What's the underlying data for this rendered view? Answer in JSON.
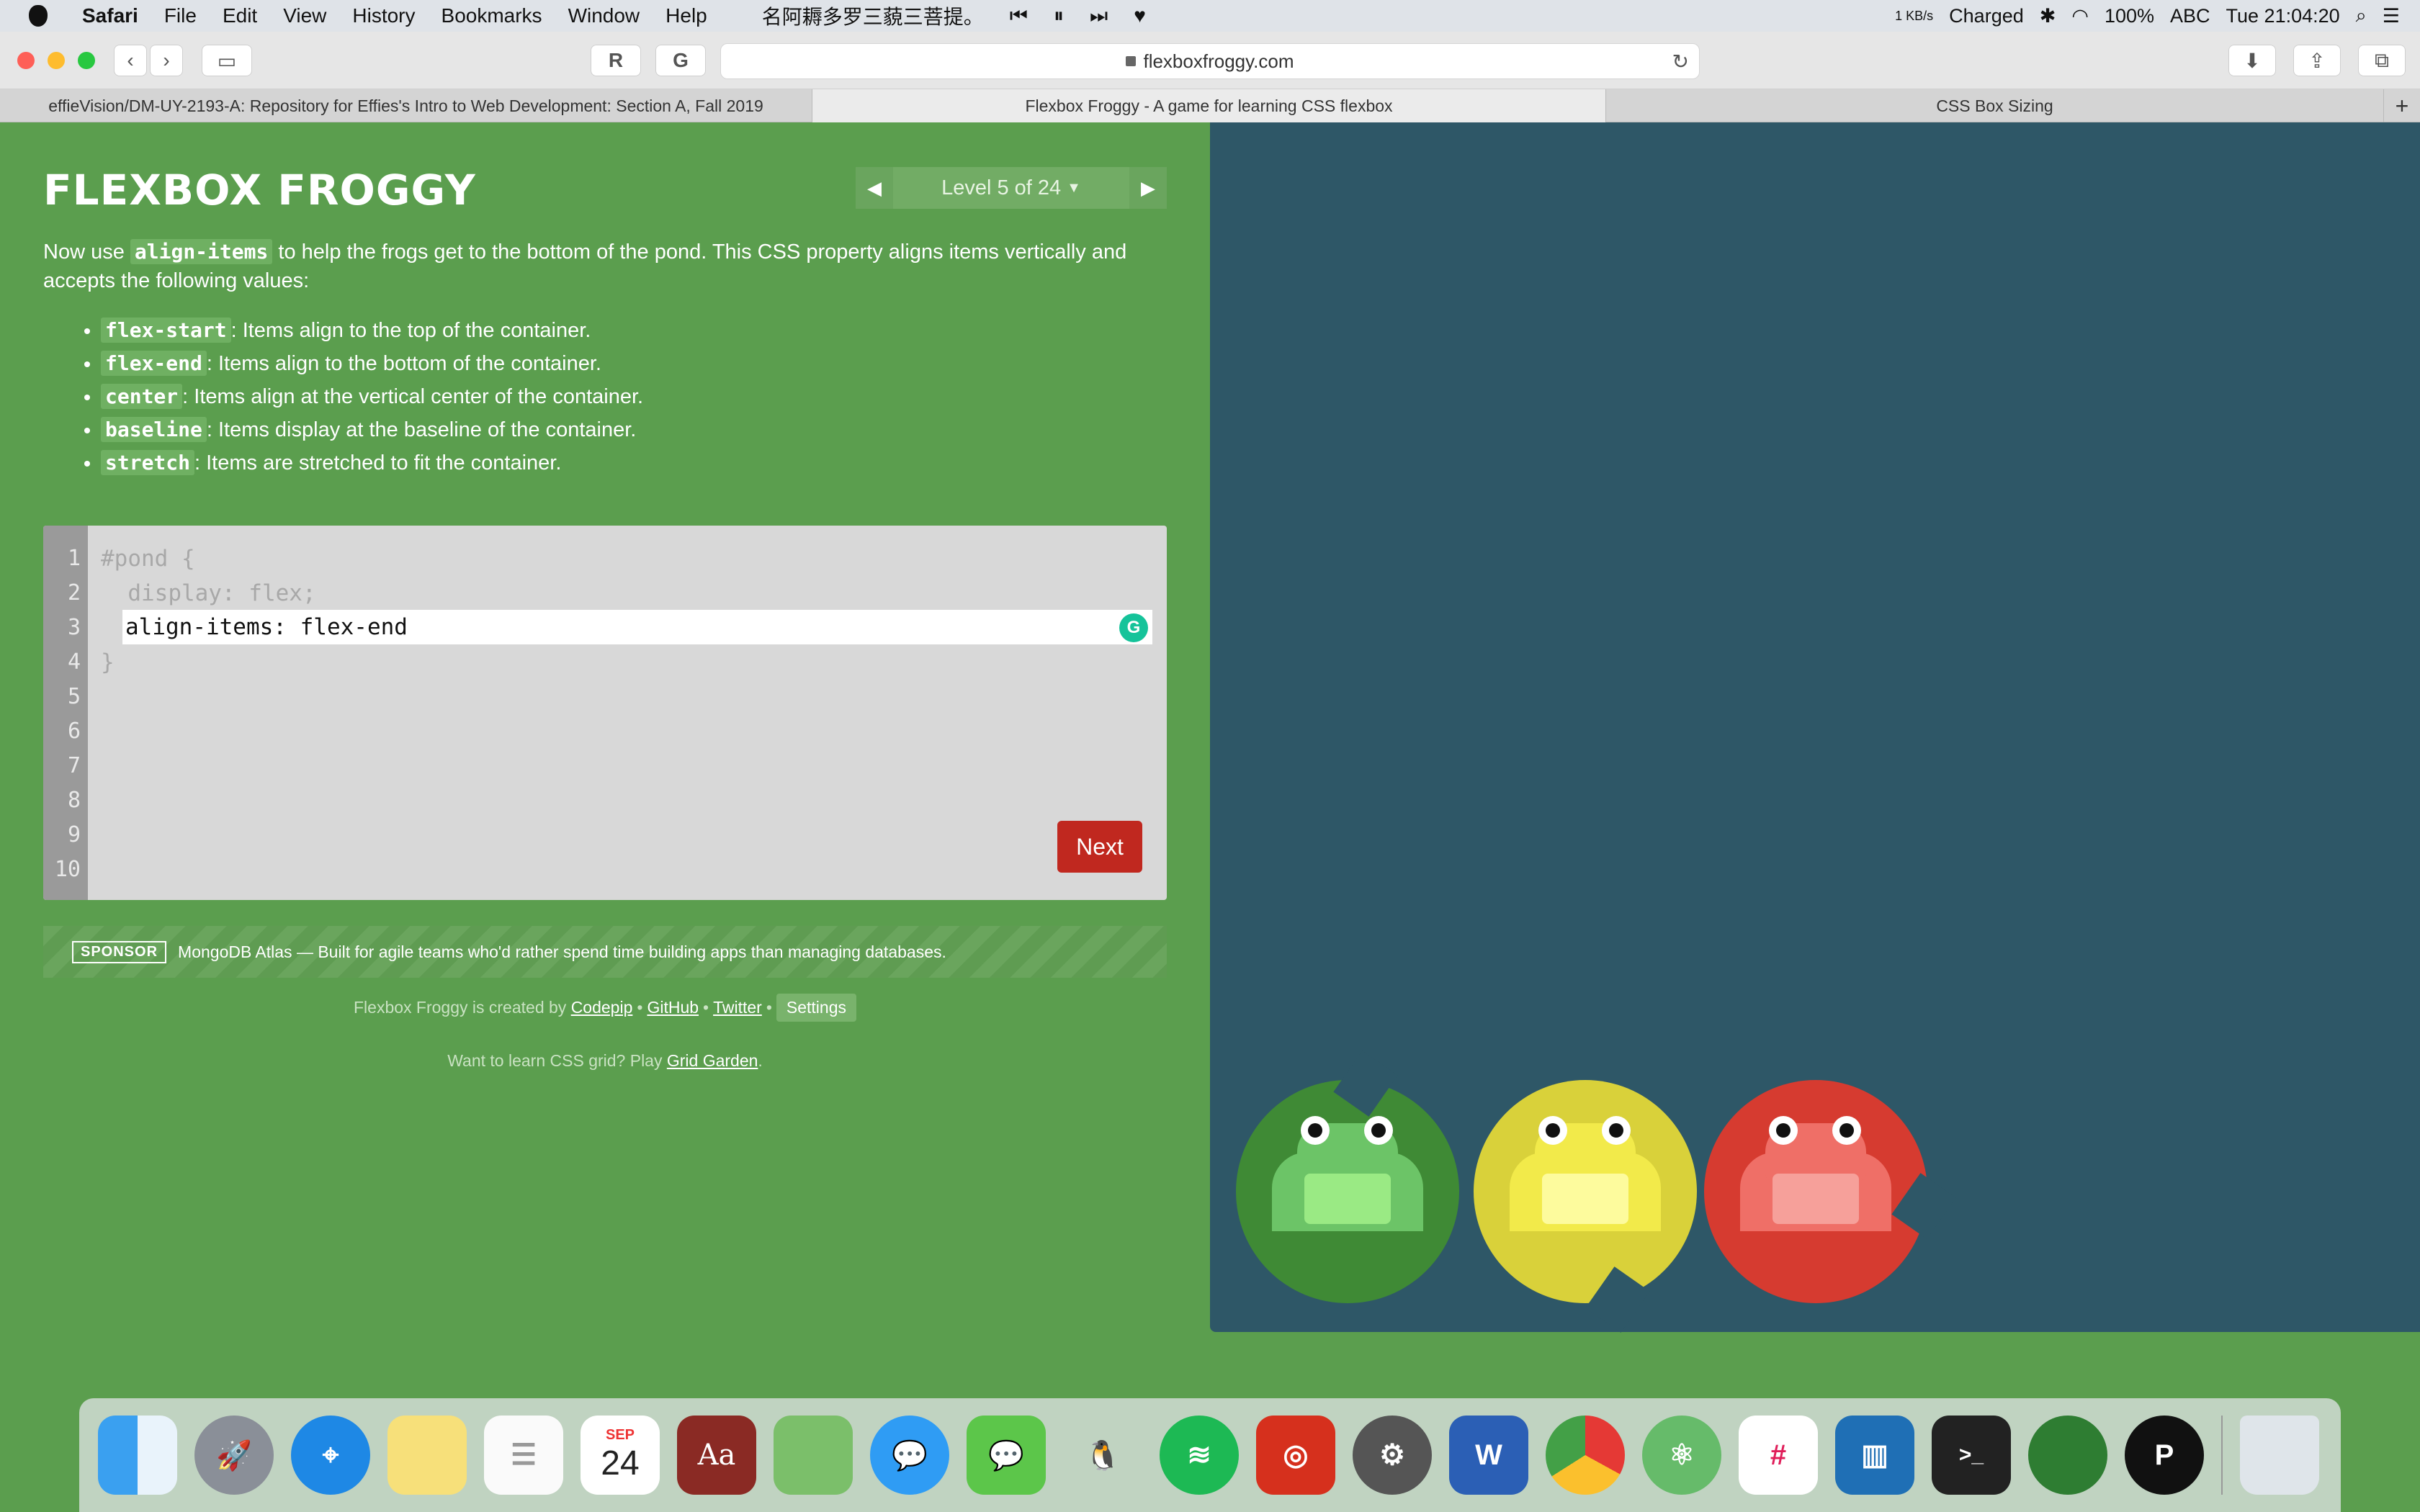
{
  "menubar": {
    "app_name": "Safari",
    "menus": [
      "File",
      "Edit",
      "View",
      "History",
      "Bookmarks",
      "Window",
      "Help"
    ],
    "now_playing": "名阿耨多罗三藐三菩提。",
    "network": "1 KB/s",
    "battery_status": "Charged",
    "battery_percent": "100%",
    "input_source": "ABC",
    "clock": "Tue 21:04:20"
  },
  "toolbar": {
    "url": "flexboxfroggy.com"
  },
  "tabs": [
    {
      "label": "effieVision/DM-UY-2193-A: Repository for Effies's Intro to Web Development: Section A, Fall 2019",
      "active": false
    },
    {
      "label": "Flexbox Froggy - A game for learning CSS flexbox",
      "active": true
    },
    {
      "label": "CSS Box Sizing",
      "active": false
    }
  ],
  "game": {
    "title": "FLEXBOX FROGGY",
    "level_label": "Level 5 of 24",
    "instructions_before": "Now use ",
    "instructions_keyword": "align-items",
    "instructions_after": " to help the frogs get to the bottom of the pond. This CSS property aligns items vertically and accepts the following values:",
    "values": [
      {
        "keyword": "flex-start",
        "text": ": Items align to the top of the container."
      },
      {
        "keyword": "flex-end",
        "text": ": Items align to the bottom of the container."
      },
      {
        "keyword": "center",
        "text": ": Items align at the vertical center of the container."
      },
      {
        "keyword": "baseline",
        "text": ": Items display at the baseline of the container."
      },
      {
        "keyword": "stretch",
        "text": ": Items are stretched to fit the container."
      }
    ]
  },
  "editor": {
    "line_numbers": "1\n2\n3\n4\n5\n6\n7\n8\n9\n10",
    "line1": "#pond {",
    "line2": "  display: flex;",
    "input_value": "align-items: flex-end",
    "line4": "}",
    "next_label": "Next",
    "grammarly_label": "G"
  },
  "sponsor": {
    "badge": "SPONSOR",
    "text": "MongoDB Atlas — Built for agile teams who'd rather spend time building apps than managing databases."
  },
  "footer": {
    "created_by": "Flexbox Froggy is created by",
    "codepip": "Codepip",
    "github": "GitHub",
    "twitter": "Twitter",
    "settings": "Settings",
    "grid_prefix": "Want to learn CSS grid? Play",
    "grid_link": "Grid Garden",
    "grid_suffix": "."
  },
  "pond": {
    "frogs": [
      {
        "color": "green",
        "pad": "#3f8a35",
        "frog": "#6cc467",
        "belly": "#9aea84"
      },
      {
        "color": "yellow",
        "pad": "#d9d13a",
        "frog": "#f2ea4a",
        "belly": "#fdfb9d"
      },
      {
        "color": "red",
        "pad": "#d63b30",
        "frog": "#ef6f67",
        "belly": "#f6a09a"
      }
    ]
  },
  "dock": {
    "apps": [
      "Finder",
      "Launchpad",
      "Safari",
      "Notes",
      "Reminders",
      "Calendar",
      "Dictionary",
      "Maps",
      "Messages",
      "WeChat",
      "QQ",
      "Spotify",
      "NetEase Music",
      "System Preferences",
      "Word",
      "Chrome",
      "Atom",
      "Slack",
      "Trello",
      "Terminal",
      "Sourcetree",
      "Pixelmator",
      "Trash"
    ],
    "calendar_month": "SEP",
    "calendar_day": "24"
  }
}
